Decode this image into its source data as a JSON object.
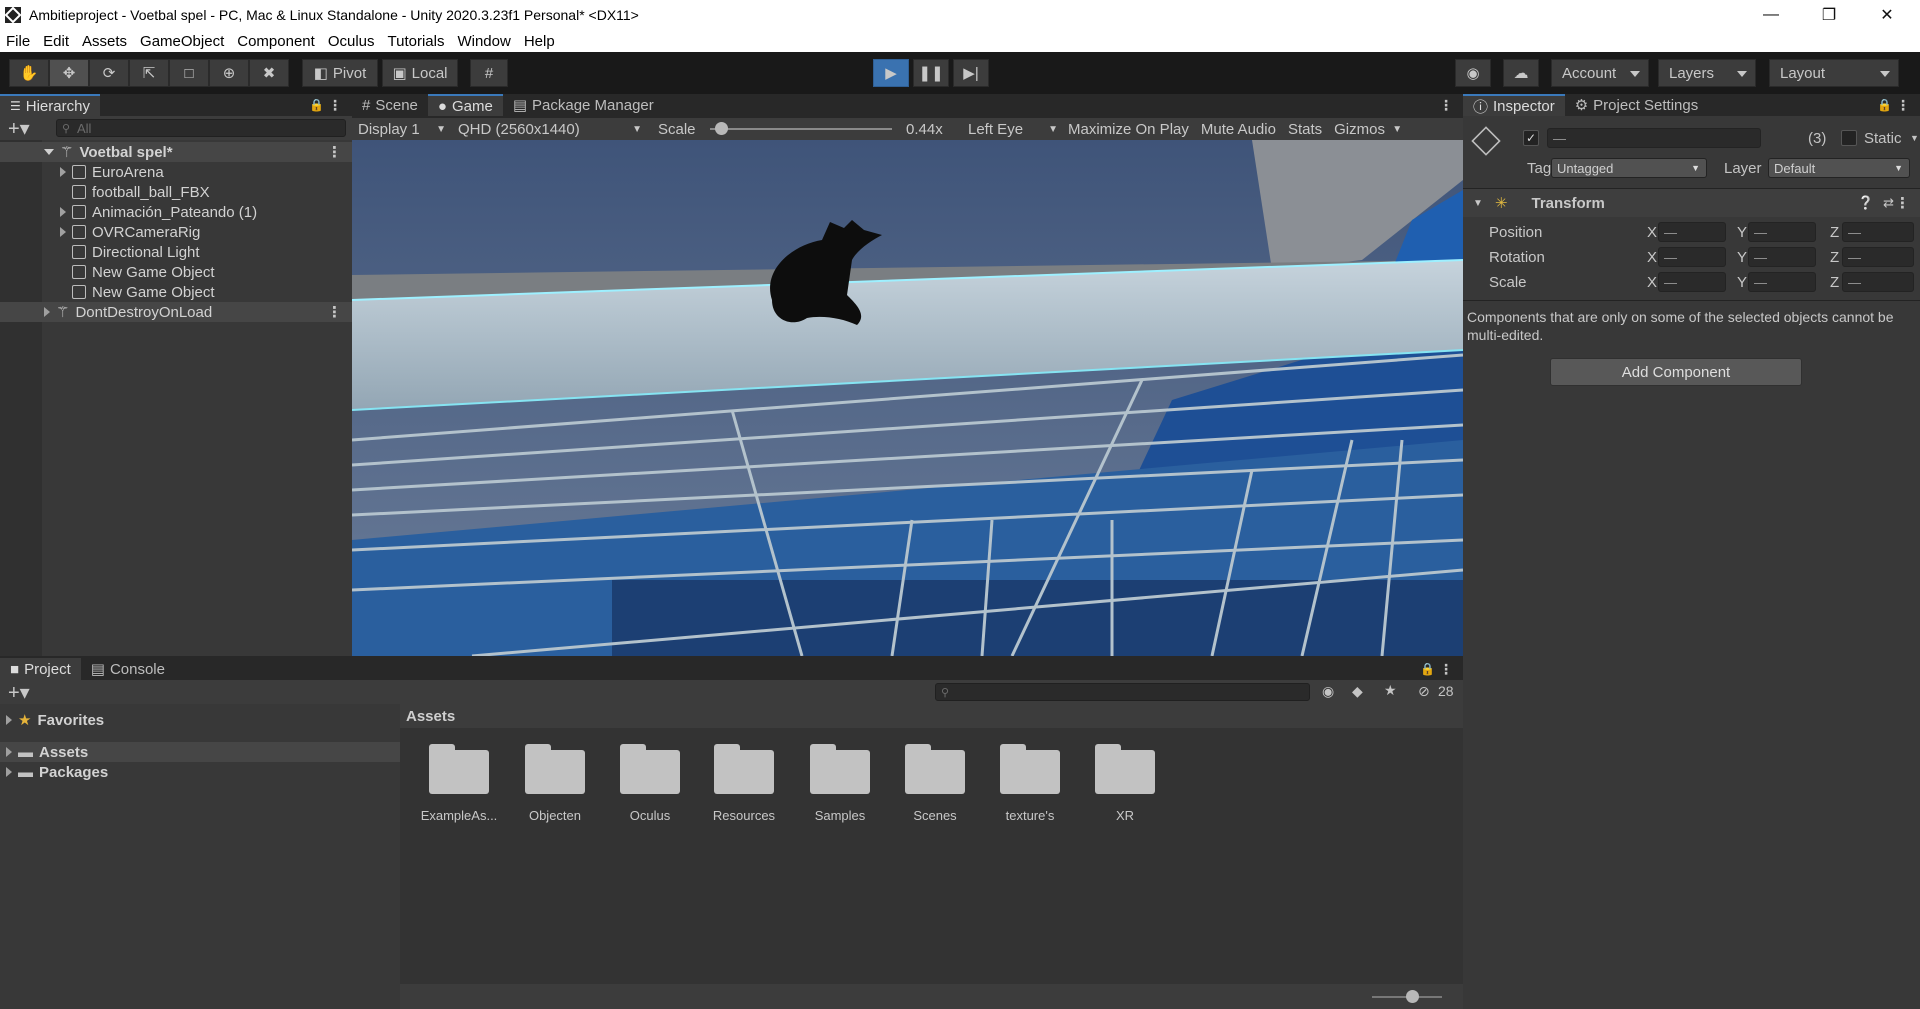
{
  "window": {
    "title": "Ambitieproject - Voetbal spel - PC, Mac & Linux Standalone - Unity 2020.3.23f1 Personal* <DX11>",
    "controls": [
      "minimize-icon",
      "restore-icon",
      "close-icon"
    ]
  },
  "menu": [
    "File",
    "Edit",
    "Assets",
    "GameObject",
    "Component",
    "Oculus",
    "Tutorials",
    "Window",
    "Help"
  ],
  "toolbar": {
    "pivot": "Pivot",
    "local": "Local",
    "account": "Account",
    "layers": "Layers",
    "layout": "Layout"
  },
  "hierarchy": {
    "tab": "Hierarchy",
    "search_placeholder": "All",
    "items": [
      {
        "label": "Voetbal spel*",
        "type": "scene"
      },
      {
        "label": "EuroArena",
        "type": "object"
      },
      {
        "label": "football_ball_FBX",
        "type": "object"
      },
      {
        "label": "Animación_Pateando (1)",
        "type": "object"
      },
      {
        "label": "OVRCameraRig",
        "type": "object"
      },
      {
        "label": "Directional Light",
        "type": "object"
      },
      {
        "label": "New Game Object",
        "type": "object"
      },
      {
        "label": "New Game Object",
        "type": "object"
      },
      {
        "label": "DontDestroyOnLoad",
        "type": "scene"
      }
    ]
  },
  "center_tabs": [
    "Scene",
    "Game",
    "Package Manager"
  ],
  "game_bar": {
    "display": "Display 1",
    "resolution": "QHD (2560x1440)",
    "scale_label": "Scale",
    "scale_value": "0.44x",
    "scale_fraction": 0.06,
    "eye": "Left Eye",
    "maximize": "Maximize On Play",
    "mute": "Mute Audio",
    "stats": "Stats",
    "gizmos": "Gizmos"
  },
  "inspector": {
    "tabs": [
      "Inspector",
      "Project Settings"
    ],
    "name_value": "—",
    "count": "(3)",
    "static_label": "Static",
    "tag_label": "Tag",
    "tag_value": "Untagged",
    "layer_label": "Layer",
    "layer_value": "Default",
    "component": "Transform",
    "rows": [
      {
        "label": "Position",
        "x": "—",
        "y": "—",
        "z": "—"
      },
      {
        "label": "Rotation",
        "x": "—",
        "y": "—",
        "z": "—"
      },
      {
        "label": "Scale",
        "x": "—",
        "y": "—",
        "z": "—"
      }
    ],
    "axes": [
      "X",
      "Y",
      "Z"
    ],
    "note": "Components that are only on some of the selected objects cannot be multi-edited.",
    "add_component": "Add Component"
  },
  "project": {
    "tabs": [
      "Project",
      "Console"
    ],
    "hidden_count": "28",
    "tree": [
      {
        "label": "Favorites",
        "icon": "star-icon"
      },
      {
        "label": "Assets",
        "icon": "folder-icon"
      },
      {
        "label": "Packages",
        "icon": "folder-icon"
      }
    ],
    "breadcrumb": "Assets",
    "folders": [
      "ExampleAs...",
      "Objecten",
      "Oculus",
      "Resources",
      "Samples",
      "Scenes",
      "texture's",
      "XR"
    ]
  }
}
